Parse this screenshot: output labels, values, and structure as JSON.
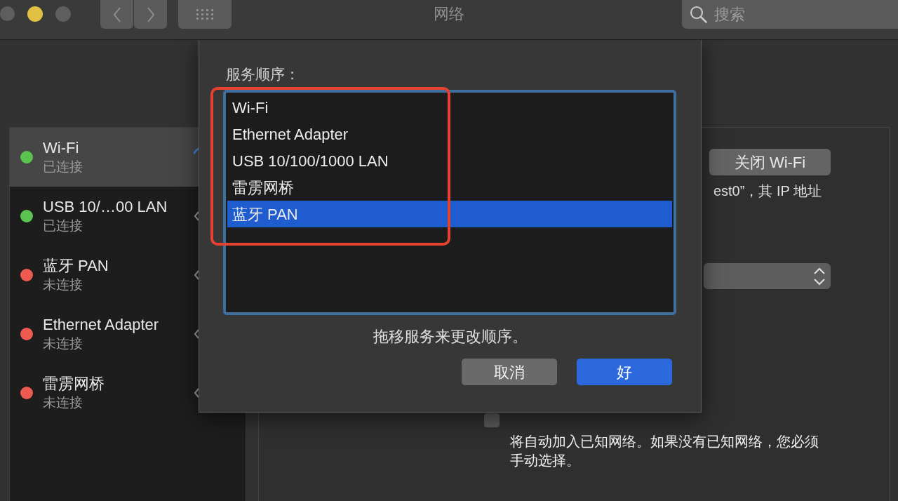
{
  "window": {
    "title": "网络",
    "search": {
      "placeholder": "搜索"
    }
  },
  "sidebar": {
    "services": [
      {
        "name": "Wi-Fi",
        "status": "已连接",
        "color": "#5ac451",
        "kind": "wifi",
        "selected": true
      },
      {
        "name": "USB 10/…00 LAN",
        "status": "已连接",
        "color": "#5ac451",
        "kind": "port",
        "selected": false
      },
      {
        "name": "蓝牙 PAN",
        "status": "未连接",
        "color": "#ec5a50",
        "kind": "port",
        "selected": false
      },
      {
        "name": "Ethernet Adapter",
        "status": "未连接",
        "color": "#ec5a50",
        "kind": "port",
        "selected": false
      },
      {
        "name": "雷雳网桥",
        "status": "未连接",
        "color": "#ec5a50",
        "kind": "port",
        "selected": false
      }
    ]
  },
  "detail": {
    "toggle_button": "关闭 Wi-Fi",
    "info_text": "est0”，其 IP 地址",
    "checkbox": {
      "checked": false
    },
    "note": "将自动加入已知网络。如果没有已知网络，您必须手动选择。"
  },
  "dialog": {
    "label": "服务顺序：",
    "services": [
      {
        "name": "Wi-Fi",
        "selected": false
      },
      {
        "name": "Ethernet Adapter",
        "selected": false
      },
      {
        "name": "USB 10/100/1000 LAN",
        "selected": false
      },
      {
        "name": "雷雳网桥",
        "selected": false
      },
      {
        "name": "蓝牙 PAN",
        "selected": true
      }
    ],
    "hint": "拖移服务来更改顺序。",
    "buttons": [
      {
        "label": "取消",
        "kind": "cancel"
      },
      {
        "label": "好",
        "kind": "default"
      }
    ]
  }
}
